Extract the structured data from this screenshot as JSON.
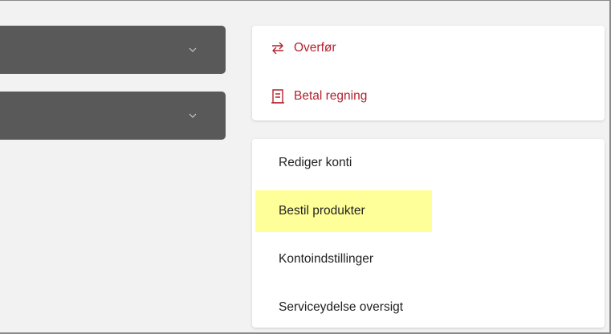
{
  "dropdowns": [
    {
      "icon": "chevron-down-icon"
    },
    {
      "icon": "chevron-down-icon"
    }
  ],
  "actions": {
    "transfer": {
      "label": "Overfør",
      "icon": "transfer-arrows-icon"
    },
    "pay_bill": {
      "label": "Betal regning",
      "icon": "bill-receipt-icon"
    }
  },
  "menu": {
    "items": [
      {
        "label": "Rediger konti"
      },
      {
        "label": "Bestil produkter",
        "highlighted": true
      },
      {
        "label": "Kontoindstillinger"
      },
      {
        "label": "Serviceydelse oversigt"
      }
    ]
  },
  "colors": {
    "accent": "#b3222f",
    "dropdown_bg": "#595959",
    "highlight": "#ffff99",
    "page_bg": "#f2f2f2"
  }
}
